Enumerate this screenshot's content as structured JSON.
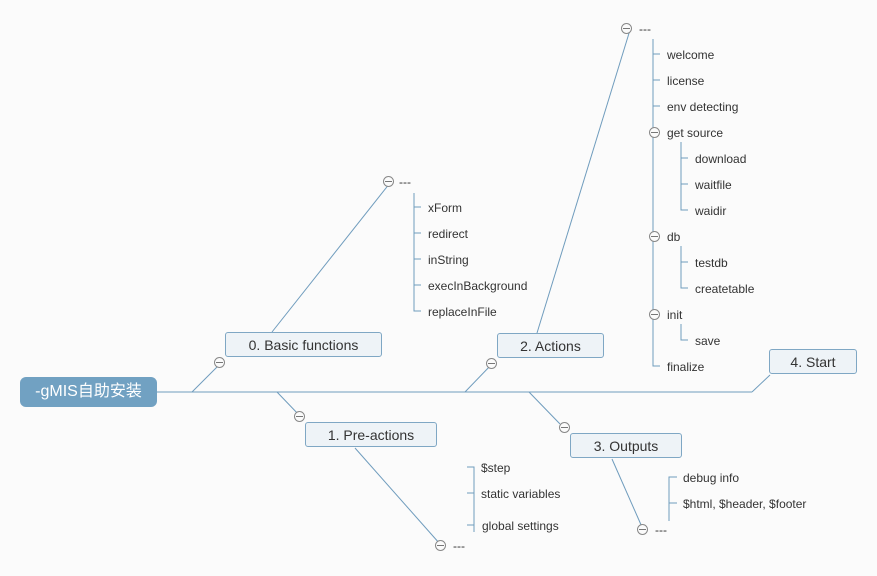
{
  "root": {
    "label": "-gMIS自助安装"
  },
  "colors": {
    "root_fill": "#71a1c2",
    "line": "#6f9cbd",
    "topic_fill": "#eef3f7",
    "topic_border": "#7fa7c4"
  },
  "topics": {
    "basic": {
      "label": "0. Basic functions",
      "group": "---",
      "items": [
        "xForm",
        "redirect",
        "inString",
        "execInBackground",
        "replaceInFile"
      ]
    },
    "pre": {
      "label": "1. Pre-actions",
      "group": "---",
      "items": [
        "$step",
        "static variables",
        "global settings"
      ]
    },
    "actions": {
      "label": "2. Actions",
      "group": "---",
      "items": [
        "welcome",
        "license",
        "env detecting",
        "get source",
        "db",
        "init",
        "finalize"
      ],
      "get_source": [
        "download",
        "waitfile",
        "waidir"
      ],
      "db": [
        "testdb",
        "createtable"
      ],
      "init": [
        "save"
      ]
    },
    "outputs": {
      "label": "3. Outputs",
      "group": "---",
      "items": [
        "debug info",
        "$html, $header, $footer"
      ]
    },
    "start": {
      "label": "4. Start"
    }
  }
}
